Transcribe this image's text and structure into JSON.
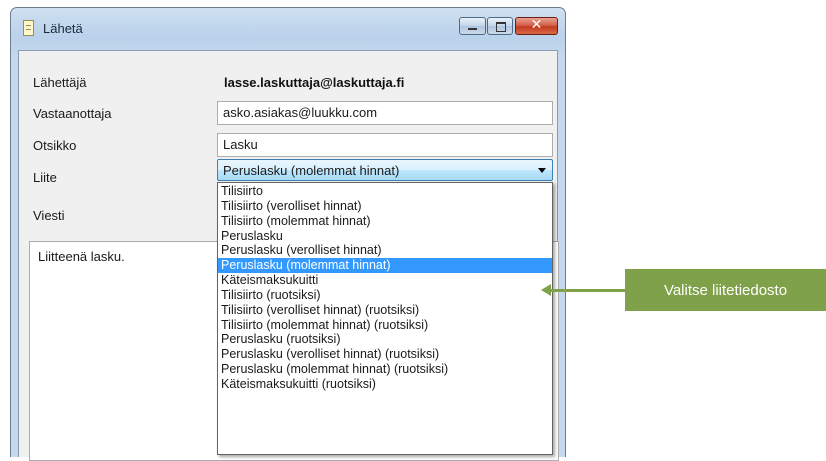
{
  "window": {
    "title": "Lähetä",
    "controls": {
      "minimize": "–",
      "maximize": "□",
      "close": "✕"
    }
  },
  "form": {
    "sender_label": "Lähettäjä",
    "sender_value": "lasse.laskuttaja@laskuttaja.fi",
    "recipient_label": "Vastaanottaja",
    "recipient_value": "asko.asiakas@luukku.com",
    "subject_label": "Otsikko",
    "subject_value": "Lasku",
    "attachment_label": "Liite",
    "attachment_selected": "Peruslasku (molemmat hinnat)",
    "message_label": "Viesti",
    "message_value": "Liitteenä lasku."
  },
  "dropdown": {
    "options": [
      "Tilisiirto",
      "Tilisiirto (verolliset hinnat)",
      "Tilisiirto (molemmat hinnat)",
      "Peruslasku",
      "Peruslasku (verolliset hinnat)",
      "Peruslasku (molemmat hinnat)",
      "Käteismaksukuitti",
      "Tilisiirto (ruotsiksi)",
      "Tilisiirto (verolliset hinnat) (ruotsiksi)",
      "Tilisiirto (molemmat hinnat) (ruotsiksi)",
      "Peruslasku (ruotsiksi)",
      "Peruslasku (verolliset hinnat) (ruotsiksi)",
      "Peruslasku (molemmat hinnat) (ruotsiksi)",
      "Käteismaksukuitti (ruotsiksi)"
    ],
    "selected_index": 5
  },
  "callout": {
    "text": "Valitse liitetiedosto",
    "color": "#7fa14a"
  }
}
